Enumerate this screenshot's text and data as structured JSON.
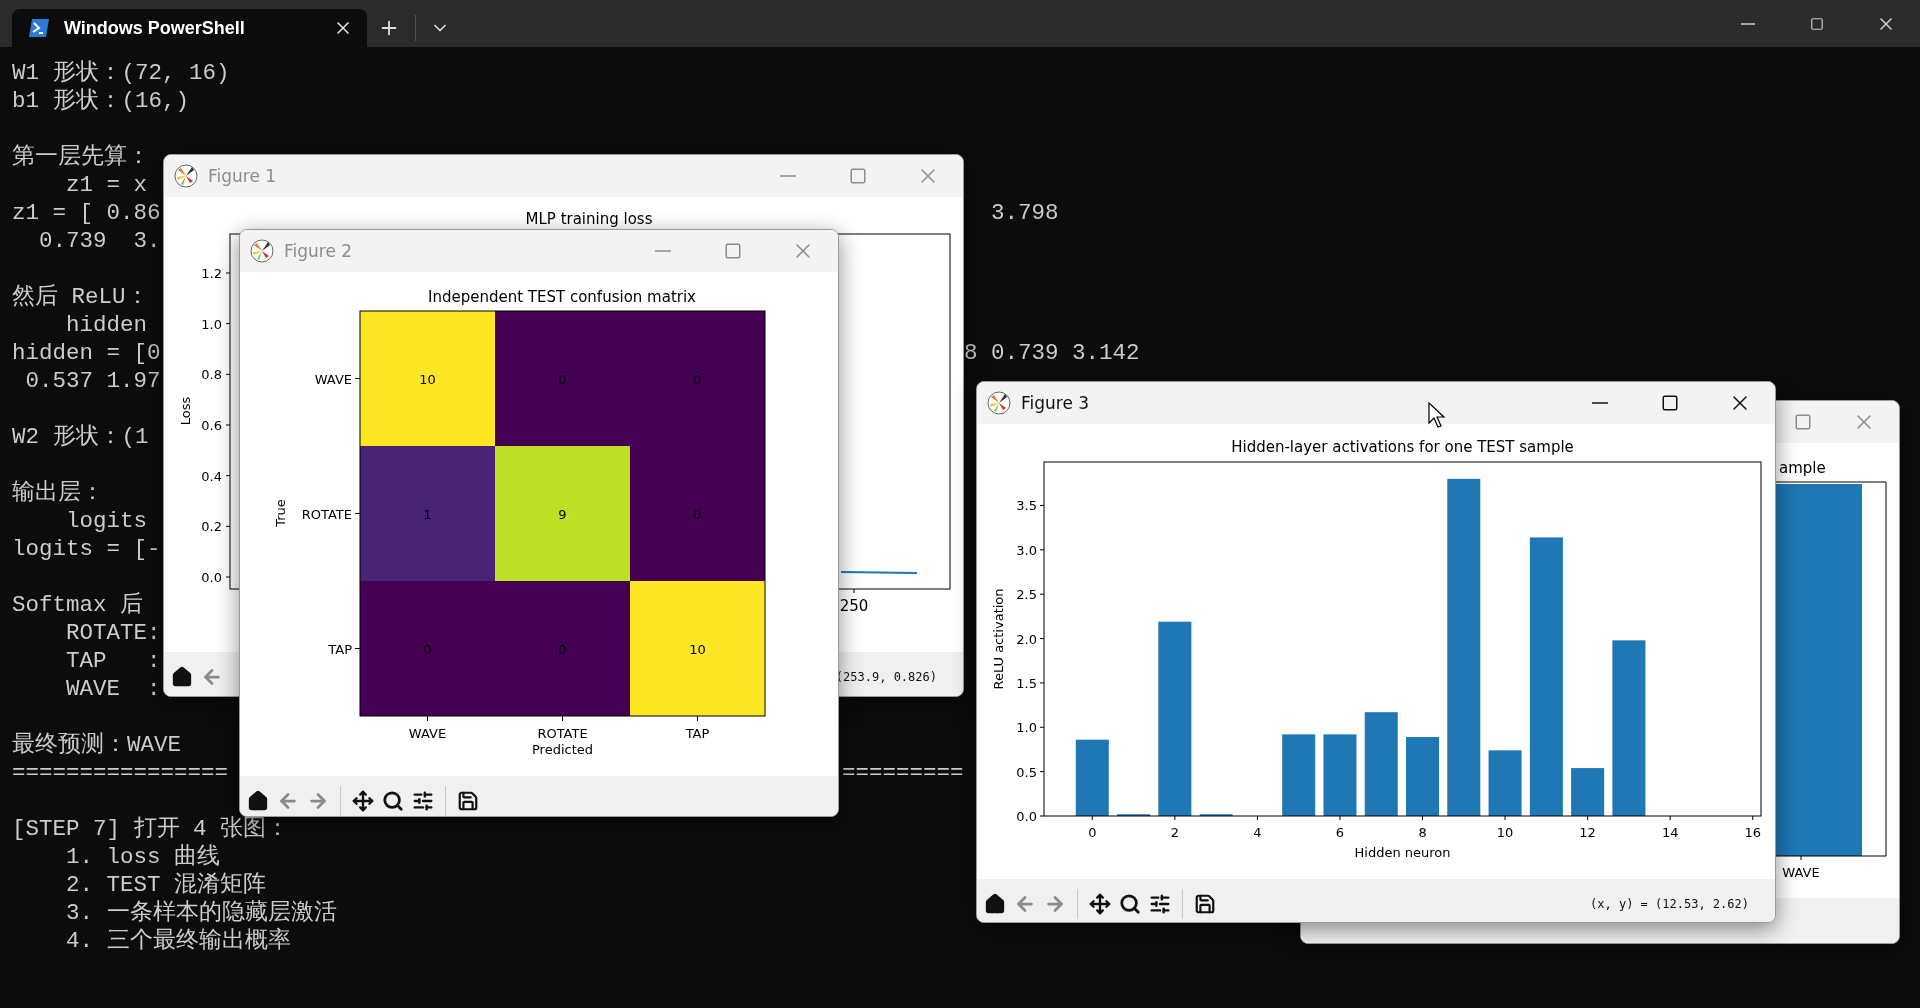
{
  "terminal": {
    "tab": {
      "title": "Windows PowerShell",
      "selected": true
    },
    "blocks": [
      [
        {
          "text": "W1 形状：(72, 16)"
        },
        {
          "text": "b1 形状：(16,)"
        }
      ],
      [
        {
          "text": "第一层先算："
        },
        {
          "text": "    z1 = x"
        },
        {
          "text": "z1 = [ 0.86",
          "tail": "3.798"
        },
        {
          "text": "  0.739  3."
        }
      ],
      [
        {
          "text": "然后 ReLU："
        },
        {
          "text": "    hidden"
        },
        {
          "text": "hidden = [0",
          "tail": "8 0.739 3.142"
        },
        {
          "text": " 0.537 1.97"
        }
      ],
      [
        {
          "text": "W2 形状：(1"
        }
      ],
      [
        {
          "text": "输出层："
        },
        {
          "text": "    logits"
        },
        {
          "text": "logits = [-"
        }
      ],
      [
        {
          "text": "Softmax 后"
        },
        {
          "text": "    ROTATE:"
        },
        {
          "text": "    TAP   :"
        },
        {
          "text": "    WAVE  :"
        }
      ],
      [
        {
          "text": "最终预测：WAVE"
        },
        {
          "text": "================",
          "tail": "========="
        }
      ],
      [
        {
          "text": "[STEP 7] 打开 4 张图："
        },
        {
          "text": "    1. loss 曲线"
        },
        {
          "text": "    2. TEST 混淆矩阵"
        },
        {
          "text": "    3. 一条样本的隐藏层激活"
        },
        {
          "text": "    4. 三个最终输出概率"
        }
      ]
    ]
  },
  "back_figure": {
    "title_fragment": "ample",
    "xtick": "WAVE"
  },
  "figure_windows": [
    {
      "kind": "loss",
      "title": "Figure 1",
      "active": false,
      "chart_title": "MLP training loss",
      "ylabel": "Loss",
      "yticks": [
        "1.2",
        "1.0",
        "0.8",
        "0.6",
        "0.4",
        "0.2",
        "0.0"
      ],
      "xtick": "250",
      "coords": "(253.9, 0.826)"
    },
    {
      "kind": "matrix",
      "title": "Figure 2",
      "active": false,
      "matrix": {
        "title": "Independent TEST confusion matrix",
        "xlabel": "Predicted",
        "ylabel": "True",
        "rows": [
          {
            "label": "WAVE",
            "cells": [
              {
                "value": "10",
                "color": "#fde725"
              },
              {
                "value": "0",
                "color": "#440154"
              },
              {
                "value": "0",
                "color": "#440154"
              }
            ]
          },
          {
            "label": "ROTATE",
            "cells": [
              {
                "value": "1",
                "color": "#482475"
              },
              {
                "value": "9",
                "color": "#bddf26"
              },
              {
                "value": "0",
                "color": "#440154"
              }
            ]
          },
          {
            "label": "TAP",
            "cells": [
              {
                "value": "0",
                "color": "#440154"
              },
              {
                "value": "0",
                "color": "#440154"
              },
              {
                "value": "10",
                "color": "#fde725"
              }
            ]
          }
        ],
        "xticks": [
          "WAVE",
          "ROTATE",
          "TAP"
        ]
      }
    },
    {
      "kind": "bars",
      "title": "Figure 3",
      "active": true,
      "coords": "(x, y) = (12.53, 2.62)",
      "chart_data": {
        "type": "bar",
        "title": "Hidden-layer activations for one TEST sample",
        "xlabel": "Hidden neuron",
        "ylabel": "ReLU activation",
        "x": [
          0,
          1,
          2,
          3,
          4,
          5,
          6,
          7,
          8,
          9,
          10,
          11,
          12,
          13,
          14,
          15
        ],
        "values": [
          0.86,
          0.02,
          2.19,
          0.02,
          0,
          0.92,
          0.92,
          1.17,
          0.89,
          3.8,
          0.74,
          3.14,
          0.54,
          1.98,
          0,
          0
        ],
        "xlim": [
          -1.17,
          16.2
        ],
        "ylim": [
          0,
          3.99
        ],
        "xticks": [
          0,
          2,
          4,
          6,
          8,
          10,
          12,
          14,
          16
        ],
        "yticks": [
          {
            "value": 0,
            "label": "0.0"
          },
          {
            "value": 0.5,
            "label": "0.5"
          },
          {
            "value": 1,
            "label": "1.0"
          },
          {
            "value": 1.5,
            "label": "1.5"
          },
          {
            "value": 2,
            "label": "2.0"
          },
          {
            "value": 2.5,
            "label": "2.5"
          },
          {
            "value": 3,
            "label": "3.0"
          },
          {
            "value": 3.5,
            "label": "3.5"
          }
        ]
      }
    }
  ]
}
